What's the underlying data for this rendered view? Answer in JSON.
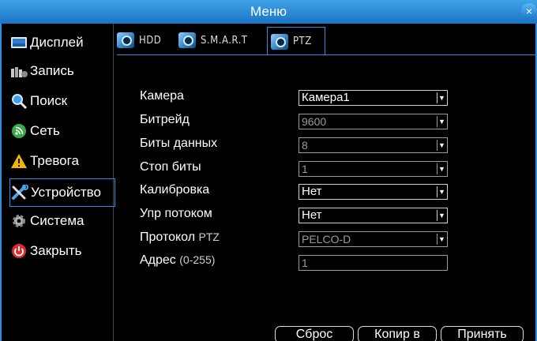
{
  "window": {
    "title": "Меню",
    "close_glyph": "×"
  },
  "sidebar": {
    "items": [
      {
        "label": "Дисплей",
        "icon": "display-icon"
      },
      {
        "label": "Запись",
        "icon": "record-icon"
      },
      {
        "label": "Поиск",
        "icon": "search-icon"
      },
      {
        "label": "Сеть",
        "icon": "network-icon"
      },
      {
        "label": "Тревога",
        "icon": "alarm-icon"
      },
      {
        "label": "Устройство",
        "icon": "tools-icon",
        "active": true
      },
      {
        "label": "Система",
        "icon": "gear-icon"
      },
      {
        "label": "Закрыть",
        "icon": "power-icon"
      }
    ]
  },
  "tabs": [
    {
      "label": "HDD",
      "icon": "hdd-icon"
    },
    {
      "label": "S.M.A.R.T",
      "icon": "smart-icon"
    },
    {
      "label": "PTZ",
      "icon": "ptz-icon",
      "active": true
    }
  ],
  "form": {
    "camera": {
      "label": "Камера",
      "value": "Камера1"
    },
    "bitrate": {
      "label": "Битрейд",
      "value": "9600"
    },
    "data_bits": {
      "label": "Биты данных",
      "value": "8"
    },
    "stop_bits": {
      "label": "Стоп биты",
      "value": "1"
    },
    "calibration": {
      "label": "Калибровка",
      "value": "Нет"
    },
    "flow_control": {
      "label": "Упр потоком",
      "value": "Нет"
    },
    "protocol": {
      "label": "Протокол",
      "label_suffix": "PTZ",
      "value": "PELCO-D"
    },
    "address": {
      "label": "Адрес",
      "label_suffix": "(0-255)",
      "value": "1"
    }
  },
  "buttons": {
    "reset": "Сброс",
    "copy": "Копир в",
    "apply": "Принять"
  },
  "colors": {
    "accent": "#2a8fe0",
    "titlebar": "#1c74c4",
    "background": "#000000"
  }
}
